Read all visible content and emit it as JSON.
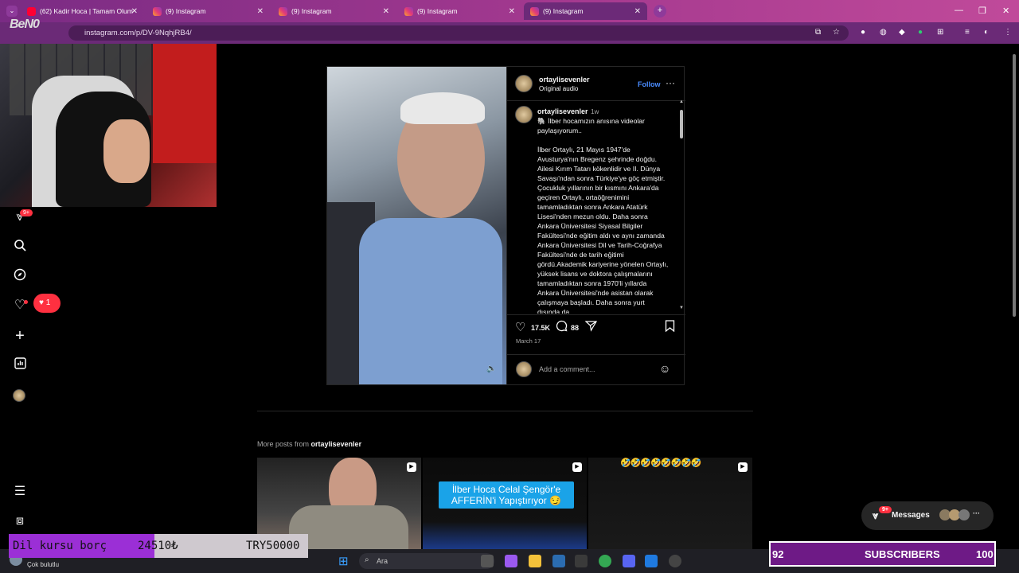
{
  "browser": {
    "tabs": [
      {
        "label": "(62) Kadir Hoca | Tamam Olum"
      },
      {
        "label": "(9) Instagram"
      },
      {
        "label": "(9) Instagram"
      },
      {
        "label": "(9) Instagram"
      },
      {
        "label": "(9) Instagram"
      }
    ],
    "new_tab": "+",
    "url": "instagram.com/p/DV-9NqhjRB4/"
  },
  "stream": {
    "cam_logo": "BeN0",
    "goal_text": "Dil kursu borç",
    "goal_current": "24510₺",
    "goal_target": "TRY50000",
    "subs_count": "92",
    "subs_label": "SUBSCRIBERS",
    "subs_goal": "100"
  },
  "nav": {
    "notif_badge": "9+",
    "likes_count": "1"
  },
  "post": {
    "username": "ortaylisevenler",
    "audio": "Original audio",
    "follow": "Follow",
    "time_ago": "1w",
    "caption": "🐘 İlber hocamızın anısına videolar paylaşıyorum..\n\nİlber Ortaylı, 21 Mayıs 1947'de Avusturya'nın Bregenz şehrinde doğdu. Ailesi Kırım Tatarı kökenlidir ve II. Dünya Savaşı'ndan sonra Türkiye'ye göç etmiştir. Çocukluk yıllarının bir kısmını Ankara'da geçiren Ortaylı, ortaöğrenimini tamamladıktan sonra Ankara Atatürk Lisesi'nden mezun oldu. Daha sonra Ankara Üniversitesi Siyasal Bilgiler Fakültesi'nde eğitim aldı ve aynı zamanda Ankara Üniversitesi Dil ve Tarih-Coğrafya Fakültesi'nde de tarih eğitimi gördü.Akademik kariyerine yönelen Ortaylı, yüksek lisans ve doktora çalışmalarını tamamladıktan sonra 1970'li yıllarda Ankara Üniversitesi'nde asistan olarak çalışmaya başladı. Daha sonra yurt dışında da",
    "likes": "17.5K",
    "comments": "88",
    "date": "March 17",
    "comment_placeholder": "Add a comment..."
  },
  "more": {
    "prefix": "More posts from ",
    "user": "ortaylisevenler",
    "thumb2_caption": "İlber Hoca Celal Şengör'e AFFERİN'i Yapıştırıyor 😏",
    "thumb3_emojis": "🤣🤣🤣🤣🤣🤣🤣🤣"
  },
  "messages": {
    "label": "Messages",
    "badge": "9+"
  },
  "taskbar": {
    "search": "Ara",
    "status": "Çok bulutlu"
  }
}
